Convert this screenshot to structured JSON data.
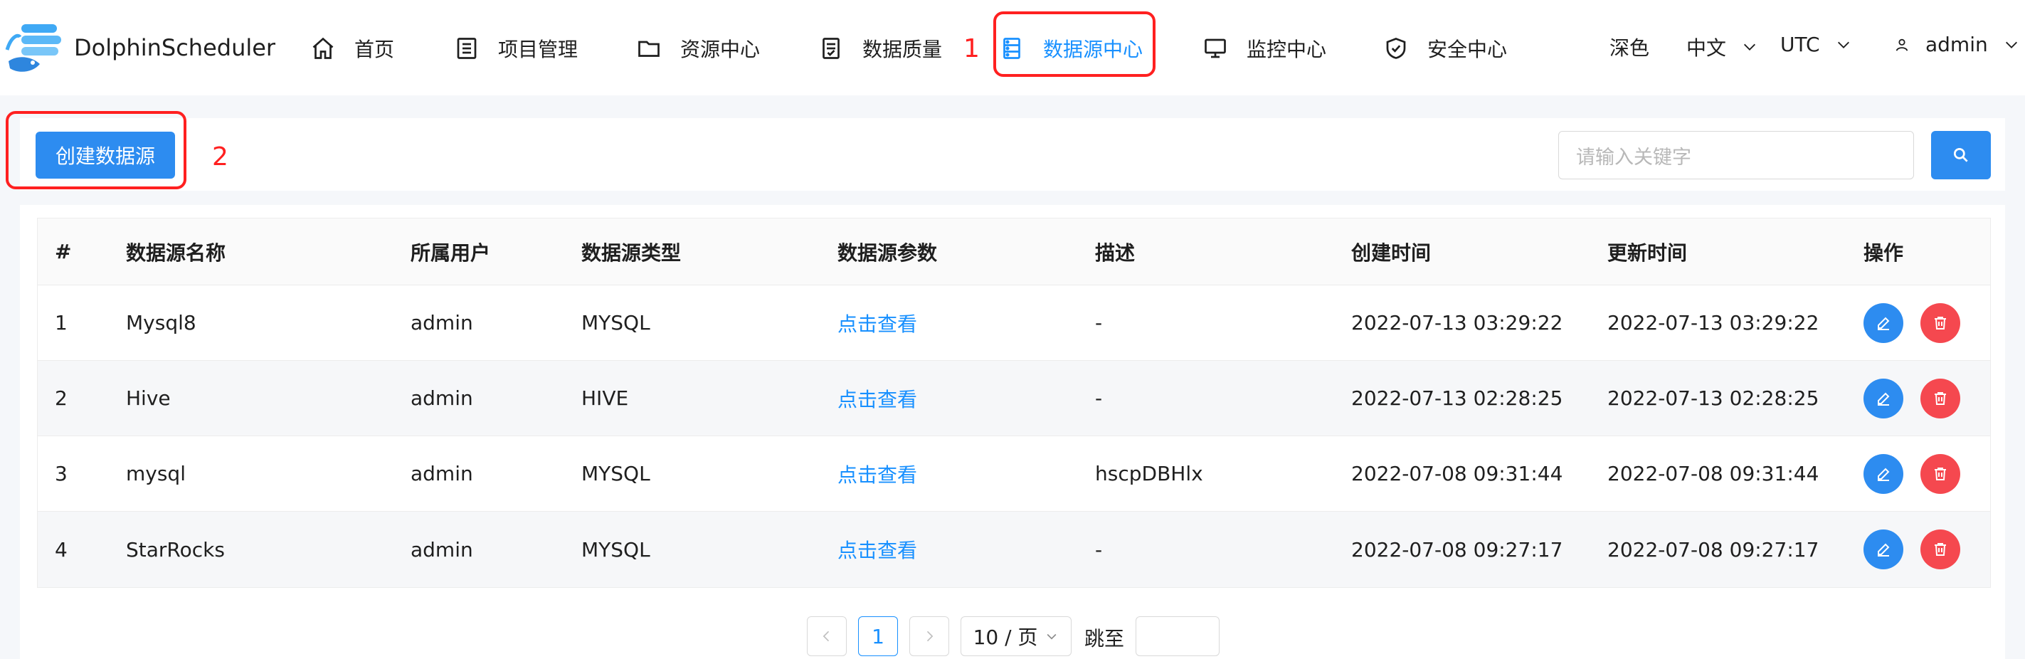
{
  "app": {
    "name": "DolphinScheduler"
  },
  "nav": {
    "items": [
      {
        "label": "首页"
      },
      {
        "label": "项目管理"
      },
      {
        "label": "资源中心"
      },
      {
        "label": "数据质量"
      },
      {
        "label": "数据源中心"
      },
      {
        "label": "监控中心"
      },
      {
        "label": "安全中心"
      }
    ],
    "active_index": 4
  },
  "header_right": {
    "theme": "深色",
    "language": "中文",
    "timezone": "UTC",
    "user": "admin"
  },
  "annotations": {
    "step1": "1",
    "step2": "2"
  },
  "toolbar": {
    "create_label": "创建数据源",
    "search_placeholder": "请输入关键字"
  },
  "table": {
    "columns": [
      "#",
      "数据源名称",
      "所属用户",
      "数据源类型",
      "数据源参数",
      "描述",
      "创建时间",
      "更新时间",
      "操作"
    ],
    "rows": [
      {
        "index": "1",
        "name": "Mysql8",
        "user": "admin",
        "type": "MYSQL",
        "params": "点击查看",
        "desc": "-",
        "created": "2022-07-13 03:29:22",
        "updated": "2022-07-13 03:29:22"
      },
      {
        "index": "2",
        "name": "Hive",
        "user": "admin",
        "type": "HIVE",
        "params": "点击查看",
        "desc": "-",
        "created": "2022-07-13 02:28:25",
        "updated": "2022-07-13 02:28:25"
      },
      {
        "index": "3",
        "name": "mysql",
        "user": "admin",
        "type": "MYSQL",
        "params": "点击查看",
        "desc": "hscpDBHlx",
        "created": "2022-07-08 09:31:44",
        "updated": "2022-07-08 09:31:44"
      },
      {
        "index": "4",
        "name": "StarRocks",
        "user": "admin",
        "type": "MYSQL",
        "params": "点击查看",
        "desc": "-",
        "created": "2022-07-08 09:27:17",
        "updated": "2022-07-08 09:27:17"
      }
    ]
  },
  "pagination": {
    "current_page": "1",
    "page_size": "10 / 页",
    "jump_label": "跳至"
  },
  "colors": {
    "primary": "#2d8cf0",
    "link": "#1890ff",
    "danger": "#f5484f",
    "highlight": "#ff2020"
  },
  "icons": {
    "nav": [
      "home-icon",
      "list-icon",
      "folder-icon",
      "document-icon",
      "database-icon",
      "monitor-icon",
      "shield-icon"
    ],
    "row_actions": [
      "edit-icon",
      "delete-icon"
    ]
  }
}
